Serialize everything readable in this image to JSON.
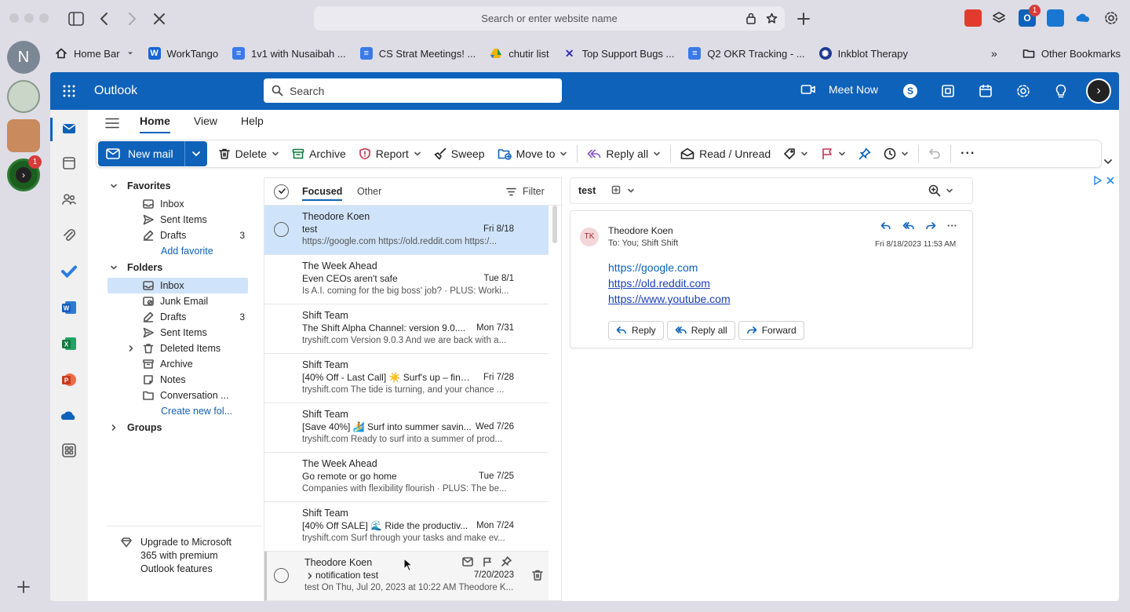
{
  "browser": {
    "url_placeholder": "Search or enter website name",
    "profile_initial": "N",
    "notification_badge": "1",
    "ext_badge": "1",
    "bookmarks": [
      {
        "label": "Home Bar",
        "icon": "home-icon"
      },
      {
        "label": "WorkTango",
        "icon": "w-icon"
      },
      {
        "label": "1v1 with Nusaibah ...",
        "icon": "doc-icon"
      },
      {
        "label": "CS Strat Meetings! ...",
        "icon": "doc-icon"
      },
      {
        "label": "chutir list",
        "icon": "drive-icon"
      },
      {
        "label": "Top Support Bugs ...",
        "icon": "x-icon"
      },
      {
        "label": "Q2 OKR Tracking - ...",
        "icon": "doc-icon"
      },
      {
        "label": "Inkblot Therapy",
        "icon": "inkblot-icon"
      }
    ],
    "other_bookmarks": "Other Bookmarks"
  },
  "app": {
    "name": "Outlook",
    "search_placeholder": "Search",
    "meet_now": "Meet Now",
    "tabs": [
      "Home",
      "View",
      "Help"
    ]
  },
  "ribbon": {
    "new_mail": "New mail",
    "delete": "Delete",
    "archive": "Archive",
    "report": "Report",
    "sweep": "Sweep",
    "move_to": "Move to",
    "reply_all": "Reply all",
    "read_unread": "Read / Unread"
  },
  "folders": {
    "favorites_label": "Favorites",
    "favorites": [
      {
        "label": "Inbox",
        "count": ""
      },
      {
        "label": "Sent Items",
        "count": ""
      },
      {
        "label": "Drafts",
        "count": "3"
      }
    ],
    "add_favorite": "Add favorite",
    "folders_label": "Folders",
    "items": [
      {
        "label": "Inbox",
        "count": ""
      },
      {
        "label": "Junk Email",
        "count": ""
      },
      {
        "label": "Drafts",
        "count": "3"
      },
      {
        "label": "Sent Items",
        "count": ""
      },
      {
        "label": "Deleted Items",
        "count": ""
      },
      {
        "label": "Archive",
        "count": ""
      },
      {
        "label": "Notes",
        "count": ""
      },
      {
        "label": "Conversation ...",
        "count": ""
      }
    ],
    "create_new": "Create new fol...",
    "groups_label": "Groups",
    "upgrade_text": "Upgrade to Microsoft 365 with premium Outlook features"
  },
  "list": {
    "focused": "Focused",
    "other": "Other",
    "filter": "Filter",
    "messages": [
      {
        "sender": "Theodore Koen",
        "subject": "test",
        "date": "Fri 8/18",
        "preview": "https://google.com https://old.reddit.com https:/..."
      },
      {
        "sender": "The Week Ahead",
        "subject": "Even CEOs aren't safe",
        "date": "Tue 8/1",
        "preview": "Is A.I. coming for the big boss' job? · PLUS: Worki..."
      },
      {
        "sender": "Shift Team",
        "subject": "The Shift Alpha Channel: version 9.0....",
        "date": "Mon 7/31",
        "preview": "tryshift.com Version 9.0.3 And we are back with a..."
      },
      {
        "sender": "Shift Team",
        "subject": "[40% Off - Last Call] ☀️ Surf's up – final ...",
        "date": "Fri 7/28",
        "preview": "tryshift.com The tide is turning, and your chance ..."
      },
      {
        "sender": "Shift Team",
        "subject": "[Save 40%] 🏄 Surf into summer savin...",
        "date": "Wed 7/26",
        "preview": "tryshift.com Ready to surf into a summer of prod..."
      },
      {
        "sender": "The Week Ahead",
        "subject": "Go remote or go home",
        "date": "Tue 7/25",
        "preview": "Companies with flexibility flourish · PLUS: The be..."
      },
      {
        "sender": "Shift Team",
        "subject": "[40% Off SALE] 🌊 Ride the productiv...",
        "date": "Mon 7/24",
        "preview": "tryshift.com Surf through your tasks and make ev..."
      },
      {
        "sender": "Theodore Koen",
        "subject": "notification test",
        "date": "7/20/2023",
        "preview": "test On Thu, Jul 20, 2023 at 10:22 AM Theodore K..."
      }
    ]
  },
  "reading": {
    "subject": "test",
    "avatar_initials": "TK",
    "from": "Theodore Koen",
    "to": "To: You; Shift Shift",
    "datetime": "Fri 8/18/2023 11:53 AM",
    "links": [
      "https://google.com",
      "https://old.reddit.com",
      "https://www.youtube.com"
    ],
    "reply": "Reply",
    "reply_all": "Reply all",
    "forward": "Forward"
  },
  "colors": {
    "brand": "#0f62b9",
    "selected_row": "#cfe4fa",
    "link": "#0f62b9"
  }
}
